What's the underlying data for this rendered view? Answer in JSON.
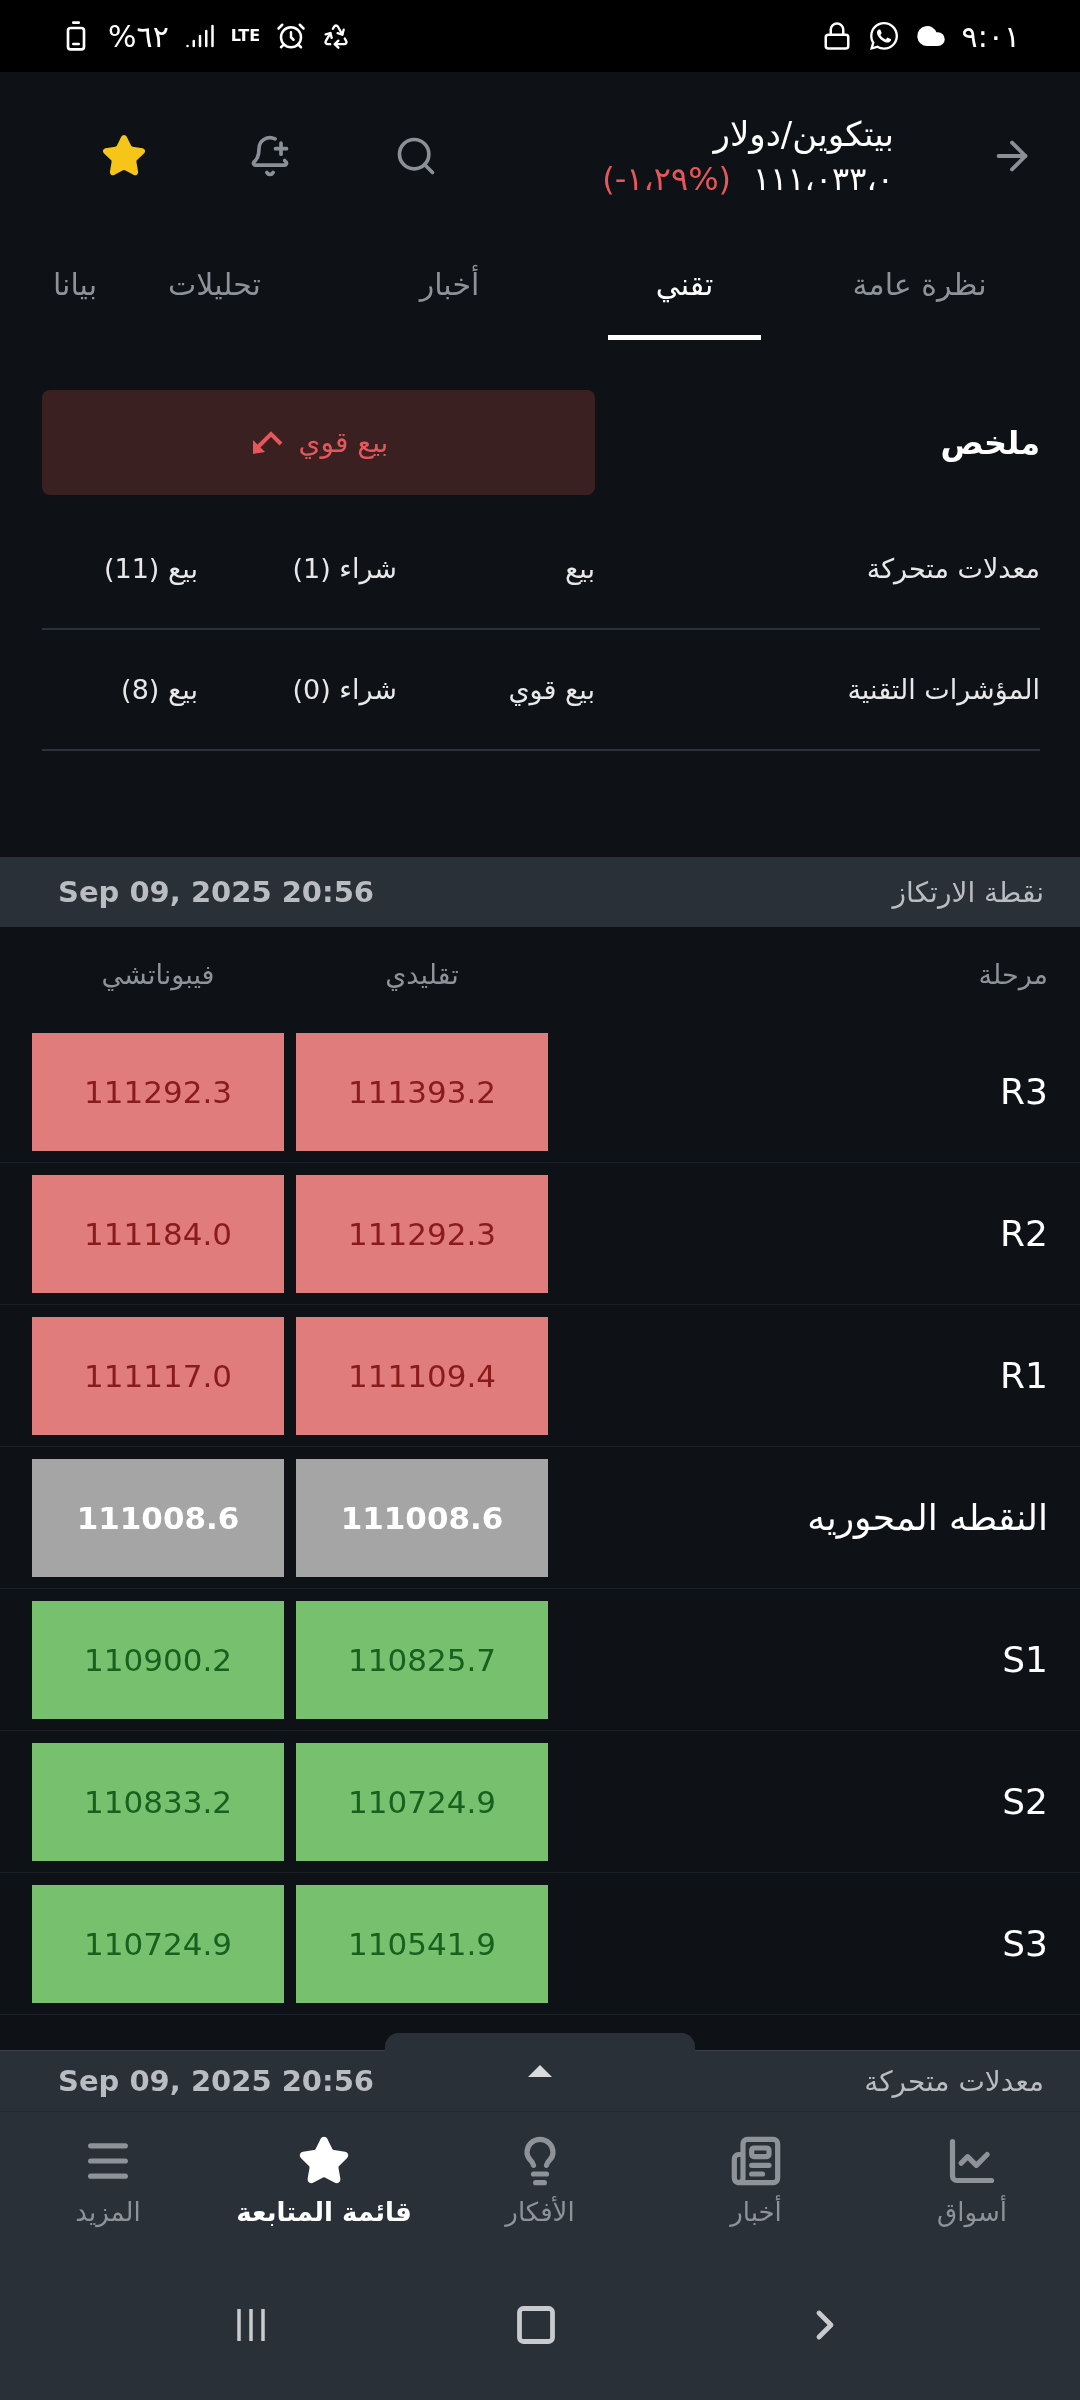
{
  "status_bar": {
    "time": "٩:٠١",
    "battery": "%٦٢",
    "network": "LTE"
  },
  "header": {
    "title": "بيتكوين/دولار",
    "price": "١١١،٠٣٣،٠",
    "change": "(-١،٢٩%)",
    "favorite": true
  },
  "tabs": [
    {
      "label": "نظرة عامة",
      "selected": false
    },
    {
      "label": "تقني",
      "selected": true
    },
    {
      "label": "أخبار",
      "selected": false
    },
    {
      "label": "تحليلات",
      "selected": false
    },
    {
      "label": "بيانا",
      "selected": false
    }
  ],
  "summary": {
    "title": "ملخص",
    "verdict": "بيع قوي",
    "rows": [
      {
        "label": "معدلات متحركة",
        "verdict": "بيع",
        "buy": "شراء (1)",
        "sell": "بيع (11)"
      },
      {
        "label": "المؤشرات التقنية",
        "verdict": "بيع قوي",
        "buy": "شراء (0)",
        "sell": "بيع (8)"
      }
    ]
  },
  "pivot": {
    "title": "نقطة الارتكاز",
    "date": "Sep 09, 2025 20:56",
    "columns": [
      "مرحلة",
      "تقليدي",
      "فيبوناتشي"
    ],
    "rows": [
      {
        "level": "R3",
        "kind": "resistance",
        "classic": "111393.2",
        "fibonacci": "111292.3"
      },
      {
        "level": "R2",
        "kind": "resistance",
        "classic": "111292.3",
        "fibonacci": "111184.0"
      },
      {
        "level": "R1",
        "kind": "resistance",
        "classic": "111109.4",
        "fibonacci": "111117.0"
      },
      {
        "level": "النقطه المحوريه",
        "kind": "pivot",
        "classic": "111008.6",
        "fibonacci": "111008.6"
      },
      {
        "level": "S1",
        "kind": "support",
        "classic": "110825.7",
        "fibonacci": "110900.2"
      },
      {
        "level": "S2",
        "kind": "support",
        "classic": "110724.9",
        "fibonacci": "110833.2"
      },
      {
        "level": "S3",
        "kind": "support",
        "classic": "110541.9",
        "fibonacci": "110724.9"
      }
    ]
  },
  "bottom_sheet": {
    "title": "معدلات متحركة",
    "date": "Sep 09, 2025 20:56"
  },
  "nav": [
    {
      "label": "أسواق",
      "kind": "markets",
      "selected": false
    },
    {
      "label": "أخبار",
      "kind": "news",
      "selected": false
    },
    {
      "label": "الأفكار",
      "kind": "ideas",
      "selected": false
    },
    {
      "label": "قائمة المتابعة",
      "kind": "watchlist",
      "selected": true
    },
    {
      "label": "المزيد",
      "kind": "more",
      "selected": false
    }
  ]
}
